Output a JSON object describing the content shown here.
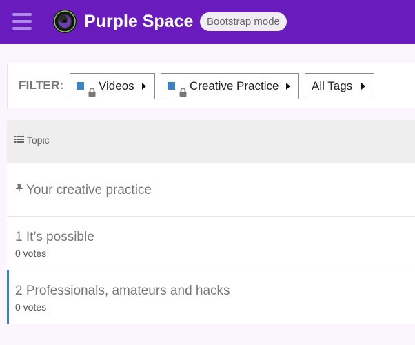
{
  "header": {
    "site_title": "Purple Space",
    "mode_badge": "Bootstrap mode",
    "brand_color": "#6a1bbd"
  },
  "filter": {
    "label": "FILTER:",
    "dropdowns": [
      {
        "label": "Videos",
        "has_color": true,
        "locked": true,
        "color": "#3a84c6"
      },
      {
        "label": "Creative Practice",
        "has_color": true,
        "locked": true,
        "color": "#3a84c6"
      },
      {
        "label": "All Tags",
        "has_color": false,
        "locked": false
      }
    ]
  },
  "table": {
    "header": "Topic",
    "rows": [
      {
        "title": "Your creative practice",
        "pinned": true
      },
      {
        "title": "1 It’s possible",
        "votes": "0 votes"
      },
      {
        "title": "2 Professionals, amateurs and hacks",
        "votes": "0 votes",
        "active": true
      }
    ]
  }
}
